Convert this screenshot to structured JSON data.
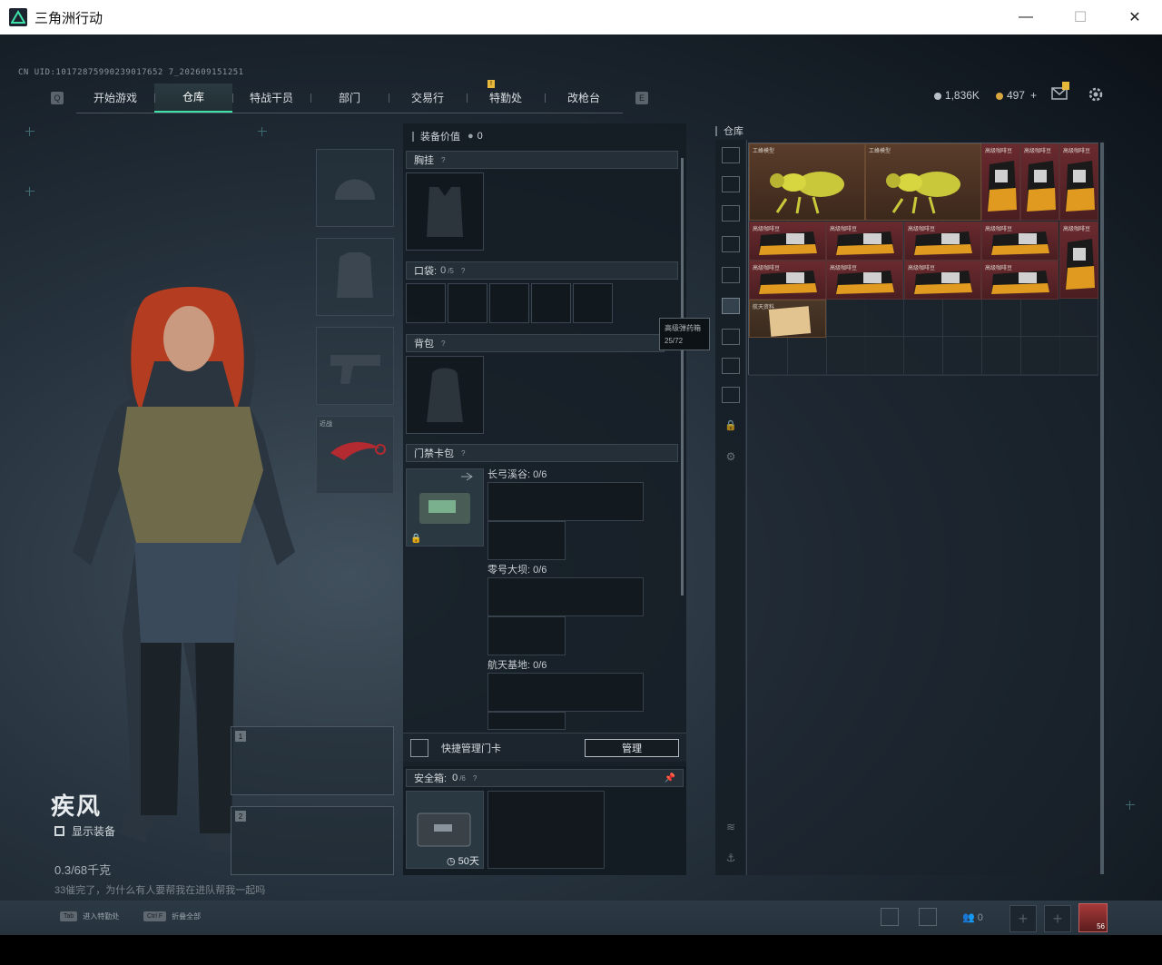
{
  "window": {
    "title": "三角洲行动",
    "min": "—",
    "max": "☐",
    "close": "✕"
  },
  "uid": "CN UID:10172875990239017652 7_202609151251",
  "nav": {
    "left_key": "Q",
    "right_key": "E",
    "tabs": [
      {
        "label": "开始游戏",
        "active": false
      },
      {
        "label": "仓库",
        "active": true
      },
      {
        "label": "特战干员",
        "active": false
      },
      {
        "label": "部门",
        "active": false
      },
      {
        "label": "交易行",
        "active": false
      },
      {
        "label": "特勤处",
        "active": false,
        "badge": "!"
      },
      {
        "label": "改枪台",
        "active": false
      }
    ]
  },
  "currency": {
    "silver": "1,836K",
    "gold": "497",
    "plus": "+"
  },
  "character": {
    "name": "疾风",
    "show_equipment": "显示装备",
    "weight": "0.3/68千克",
    "chat": "33催完了，为什么有人要帮我在进队帮我一起吗",
    "melee_label": "近战"
  },
  "loadout": {
    "header_label": "装备价值",
    "header_value": "0",
    "chest_rig": "胸挂",
    "pocket_label": "口袋:",
    "pocket_value": "0",
    "pocket_max": "/5",
    "backpack": "背包",
    "keycard_case": "门禁卡包",
    "maps": [
      {
        "name": "长弓溪谷: 0/6"
      },
      {
        "name": "零号大坝: 0/6"
      },
      {
        "name": "航天基地: 0/6"
      }
    ],
    "quick_manage": "快捷管理门卡",
    "manage_btn": "管理",
    "safe_box_label": "安全箱:",
    "safe_box_value": "0",
    "safe_box_max": "/6",
    "safe_timer": "50天"
  },
  "tooltip": {
    "title": "高级弹药箱",
    "value": "25/72"
  },
  "warehouse": {
    "title": "仓库",
    "items": [
      {
        "name": "工蜂模型"
      },
      {
        "name": "工蜂模型"
      },
      {
        "name": "高级咖啡豆"
      },
      {
        "name": "高级咖啡豆"
      },
      {
        "name": "高级咖啡豆"
      },
      {
        "name": "高级咖啡豆"
      },
      {
        "name": "高级咖啡豆"
      },
      {
        "name": "高级咖啡豆"
      },
      {
        "name": "高级咖啡豆"
      },
      {
        "name": "高级咖啡豆"
      },
      {
        "name": "高级咖啡豆"
      },
      {
        "name": "高级咖啡豆"
      },
      {
        "name": "高级咖啡豆"
      },
      {
        "name": "高级咖啡豆"
      },
      {
        "name": "高级咖啡豆"
      },
      {
        "name": "高级咖啡豆"
      },
      {
        "name": "航天资料"
      }
    ]
  },
  "bottom": {
    "hint1_key": "Tab",
    "hint1": "进入特勤处",
    "hint2_key": "Ctrl F",
    "hint2": "折叠全部",
    "friends_count": "0",
    "avatar_level": "56"
  }
}
